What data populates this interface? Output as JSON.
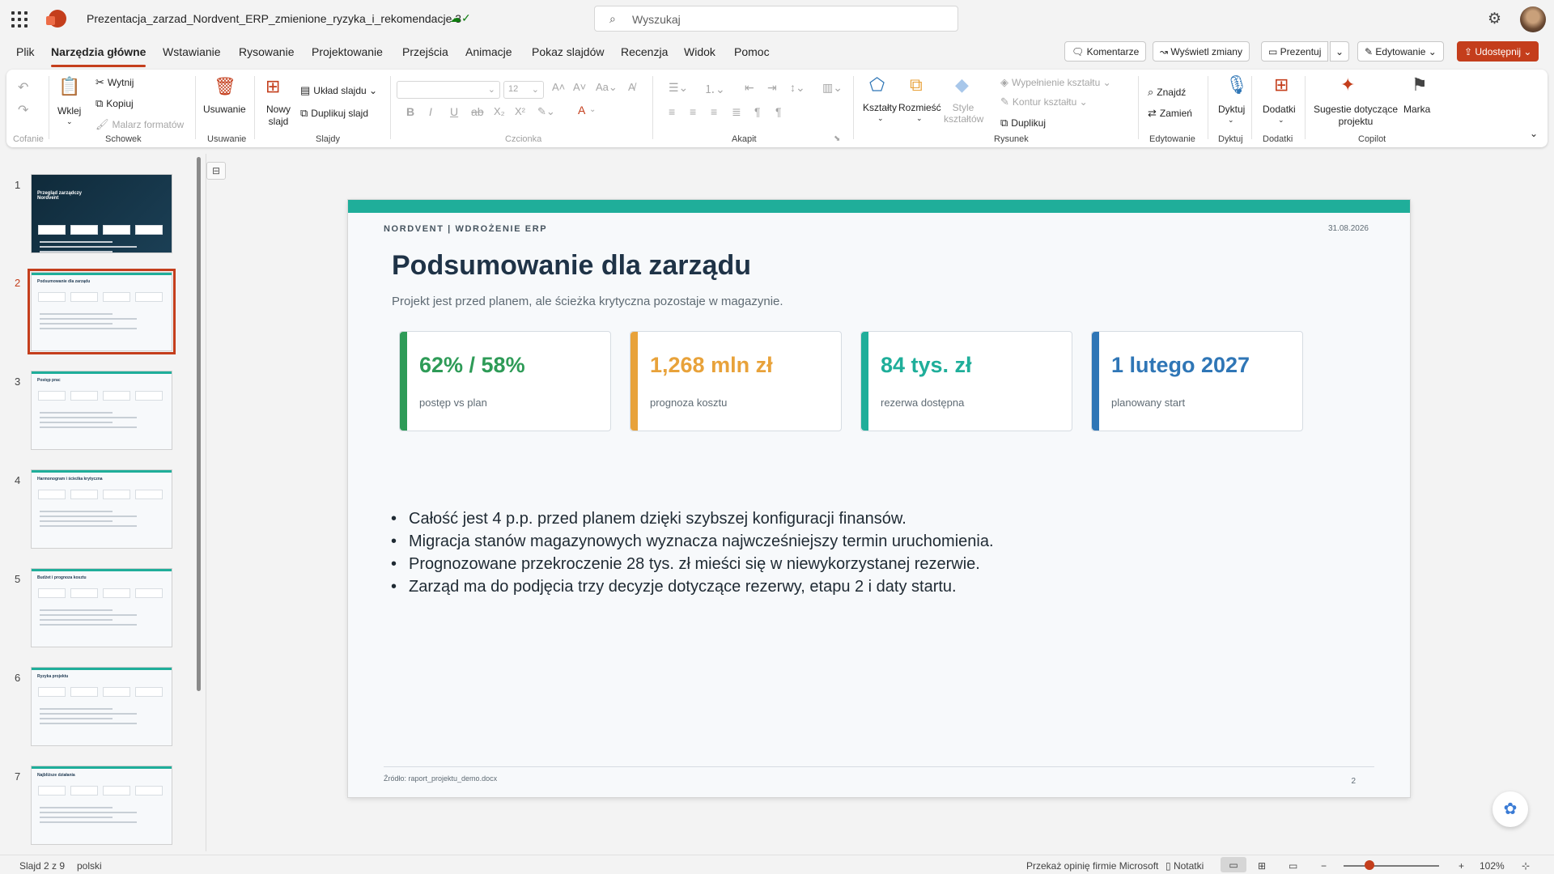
{
  "titlebar": {
    "doc_title": "Prezentacja_zarzad_Nordvent_ERP_zmienione_ryzyka_i_rekomendacje 3",
    "search_placeholder": "Wyszukaj"
  },
  "menu": {
    "items": [
      "Plik",
      "Narzędzia główne",
      "Wstawianie",
      "Rysowanie",
      "Projektowanie",
      "Przejścia",
      "Animacje",
      "Pokaz slajdów",
      "Recenzja",
      "Widok",
      "Pomoc"
    ],
    "active": "Narzędzia główne"
  },
  "actions": {
    "comments": "Komentarze",
    "show_changes": "Wyświetl zmiany",
    "present": "Prezentuj",
    "editing": "Edytowanie",
    "share": "Udostępnij"
  },
  "ribbon": {
    "undo_group": "Cofanie",
    "paste": "Wklej",
    "cut": "Wytnij",
    "copy": "Kopiuj",
    "format_painter": "Malarz formatów",
    "clipboard_group": "Schowek",
    "delete": "Usuwanie",
    "delete_group": "Usuwanie",
    "new_slide": "Nowy slajd",
    "layout": "Układ slajdu",
    "duplicate_slide": "Duplikuj slajd",
    "slides_group": "Slajdy",
    "font_size": "12",
    "font_group": "Czcionka",
    "paragraph_group": "Akapit",
    "shapes": "Kształty",
    "arrange": "Rozmieść",
    "shape_styles": "Style kształtów",
    "shape_fill": "Wypełnienie kształtu",
    "shape_outline": "Kontur kształtu",
    "duplicate": "Duplikuj",
    "drawing_group": "Rysunek",
    "find": "Znajdź",
    "replace": "Zamień",
    "editing_group": "Edytowanie",
    "dictate": "Dyktuj",
    "dictate_group": "Dyktuj",
    "addins": "Dodatki",
    "addins_group": "Dodatki",
    "suggestions": "Sugestie dotyczące projektu",
    "brand": "Marka",
    "copilot_group": "Copilot"
  },
  "thumbnails": [
    {
      "num": "1",
      "title": "Przegląd zarządczy Nordvent",
      "dark": true
    },
    {
      "num": "2",
      "title": "Podsumowanie dla zarządu",
      "selected": true
    },
    {
      "num": "3",
      "title": "Postęp prac"
    },
    {
      "num": "4",
      "title": "Harmonogram i ścieżka krytyczna"
    },
    {
      "num": "5",
      "title": "Budżet i prognoza kosztu"
    },
    {
      "num": "6",
      "title": "Ryzyka projektu"
    },
    {
      "num": "7",
      "title": "Najbliższe działania"
    }
  ],
  "slide": {
    "kicker": "NORDVENT  |  WDROŻENIE ERP",
    "date": "31.08.2026",
    "title": "Podsumowanie dla zarządu",
    "subtitle": "Projekt jest przed planem, ale ścieżka krytyczna pozostaje w magazynie.",
    "kpis": [
      {
        "value": "62% / 58%",
        "label": "postęp vs plan",
        "color": "#2e9b57"
      },
      {
        "value": "1,268 mln zł",
        "label": "prognoza kosztu",
        "color": "#e8a23a"
      },
      {
        "value": "84 tys. zł",
        "label": "rezerwa dostępna",
        "color": "#1fae9a"
      },
      {
        "value": "1 lutego 2027",
        "label": "planowany start",
        "color": "#2f76b6"
      }
    ],
    "bullets": [
      "Całość jest 4 p.p. przed planem dzięki szybszej konfiguracji finansów.",
      "Migracja stanów magazynowych wyznacza najwcześniejszy termin uruchomienia.",
      "Prognozowane przekroczenie 28 tys. zł mieści się w niewykorzystanej rezerwie.",
      "Zarząd ma do podjęcia trzy decyzje dotyczące rezerwy, etapu 2 i daty startu."
    ],
    "source": "Źródło: raport_projektu_demo.docx",
    "page": "2"
  },
  "status": {
    "slide_info": "Slajd 2 z 9",
    "language": "polski",
    "feedback": "Przekaż opinię firmie Microsoft",
    "notes": "Notatki",
    "zoom": "102%",
    "zoom_level": 0.5
  },
  "colors": {
    "accent": "#c43e1c",
    "teal": "#1fae9a",
    "title_navy": "#1f3347"
  }
}
